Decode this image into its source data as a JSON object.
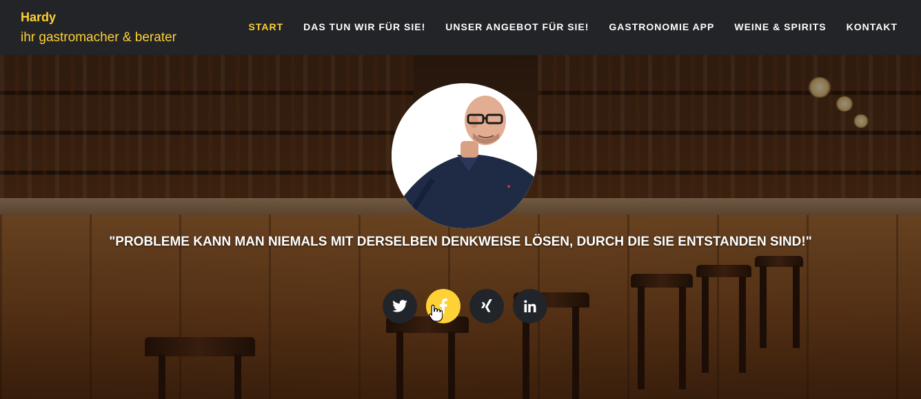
{
  "brand": {
    "name": "Hardy",
    "tagline": "ihr gastromacher & berater"
  },
  "nav": {
    "items": [
      {
        "label": "START",
        "active": true
      },
      {
        "label": "DAS TUN WIR FÜR SIE!",
        "active": false
      },
      {
        "label": "UNSER ANGEBOT FÜR SIE!",
        "active": false
      },
      {
        "label": "GASTRONOMIE APP",
        "active": false
      },
      {
        "label": "WEINE & SPIRITS",
        "active": false
      },
      {
        "label": "KONTAKT",
        "active": false
      }
    ]
  },
  "hero": {
    "quote": "\"PROBLEME KANN MAN NIEMALS MIT DERSELBEN DENKWEISE LÖSEN, DURCH DIE SIE ENTSTANDEN SIND!\""
  },
  "socials": [
    {
      "icon": "twitter-icon",
      "hovered": false
    },
    {
      "icon": "facebook-icon",
      "hovered": true
    },
    {
      "icon": "xing-icon",
      "hovered": false
    },
    {
      "icon": "linkedin-icon",
      "hovered": false
    }
  ],
  "colors": {
    "accent": "#fed136",
    "navbar": "#222427",
    "social_bg": "#212529",
    "text_light": "#ffffff"
  }
}
